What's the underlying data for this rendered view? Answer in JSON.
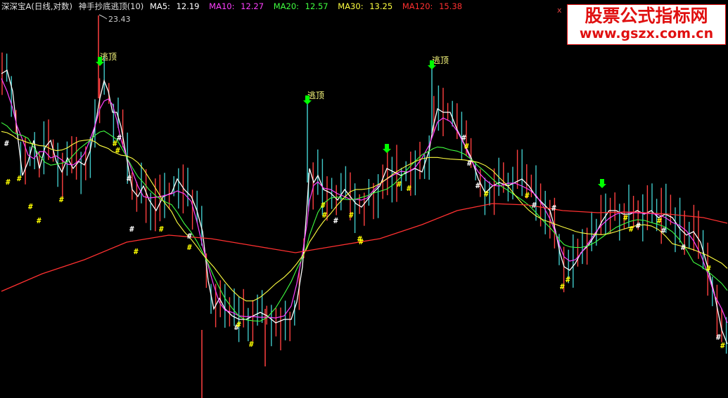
{
  "header": {
    "stock_name": "深深宝A",
    "chart_mode": "(日线,对数)",
    "indicator": "神手抄底逃顶(10)",
    "ma": [
      {
        "label": "MA5:",
        "value": "12.19",
        "color": "#ffffff"
      },
      {
        "label": "MA10:",
        "value": "12.27",
        "color": "#ff40ff"
      },
      {
        "label": "MA20:",
        "value": "12.57",
        "color": "#40ff40"
      },
      {
        "label": "MA30:",
        "value": "13.25",
        "color": "#ffff40"
      },
      {
        "label": "MA120:",
        "value": "15.38",
        "color": "#ff3030"
      }
    ]
  },
  "close_button": "x",
  "watermark": {
    "line1": "股票公式指标网",
    "line2": "www.gszx.com.cn"
  },
  "annotations": {
    "peak_price": "23.43",
    "escape_label": "逃顶",
    "bottom_mark": "#"
  },
  "colors": {
    "background": "#000000",
    "up_bar": "#ff4040",
    "down_bar": "#40c8c8",
    "price_line": "#ffffff",
    "ma5": "#ffffff",
    "ma10": "#ff40ff",
    "ma20": "#40ff40",
    "ma30": "#ffff40",
    "ma120": "#ff3030",
    "arrow": "#00ff00",
    "mark_white": "#ffffff",
    "mark_yellow": "#ffff00"
  }
}
